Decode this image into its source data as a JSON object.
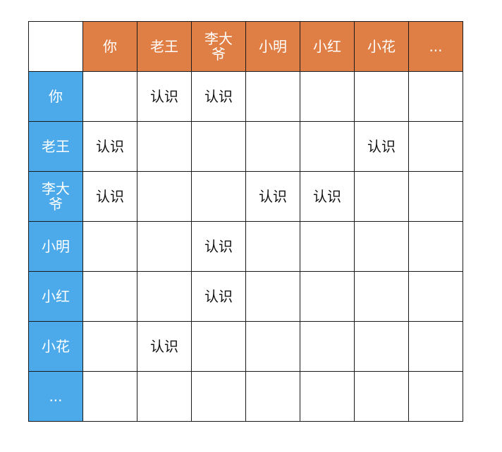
{
  "matrix": {
    "columns": [
      "你",
      "老王",
      "李大爷",
      "小明",
      "小红",
      "小花",
      "..."
    ],
    "rows": [
      {
        "label": "你",
        "cells": [
          "",
          "认识",
          "认识",
          "",
          "",
          "",
          ""
        ]
      },
      {
        "label": "老王",
        "cells": [
          "认识",
          "",
          "",
          "",
          "",
          "认识",
          ""
        ]
      },
      {
        "label": "李大爷",
        "cells": [
          "认识",
          "",
          "",
          "认识",
          "认识",
          "",
          ""
        ]
      },
      {
        "label": "小明",
        "cells": [
          "",
          "",
          "认识",
          "",
          "",
          "",
          ""
        ]
      },
      {
        "label": "小红",
        "cells": [
          "",
          "",
          "认识",
          "",
          "",
          "",
          ""
        ]
      },
      {
        "label": "小花",
        "cells": [
          "",
          "认识",
          "",
          "",
          "",
          "",
          ""
        ]
      },
      {
        "label": "...",
        "cells": [
          "",
          "",
          "",
          "",
          "",
          "",
          ""
        ]
      }
    ]
  },
  "colors": {
    "column_header_bg": "#e07f45",
    "row_header_bg": "#4daaea",
    "header_text": "#ffffff",
    "grid_line": "#1a1a1a"
  }
}
